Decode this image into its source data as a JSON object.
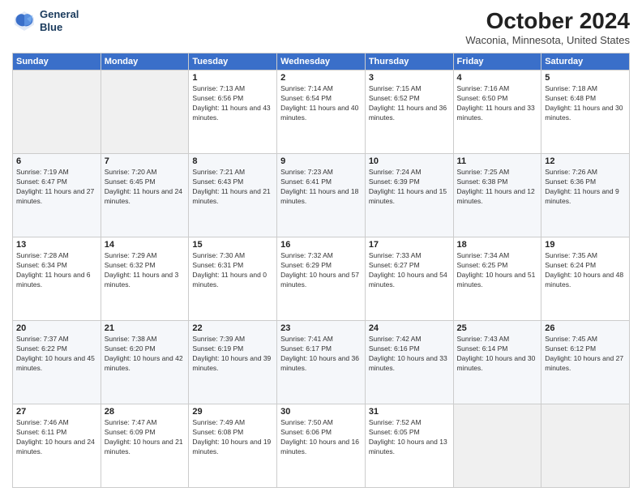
{
  "logo": {
    "line1": "General",
    "line2": "Blue"
  },
  "title": "October 2024",
  "location": "Waconia, Minnesota, United States",
  "days_of_week": [
    "Sunday",
    "Monday",
    "Tuesday",
    "Wednesday",
    "Thursday",
    "Friday",
    "Saturday"
  ],
  "weeks": [
    [
      {
        "num": "",
        "info": ""
      },
      {
        "num": "",
        "info": ""
      },
      {
        "num": "1",
        "info": "Sunrise: 7:13 AM\nSunset: 6:56 PM\nDaylight: 11 hours and 43 minutes."
      },
      {
        "num": "2",
        "info": "Sunrise: 7:14 AM\nSunset: 6:54 PM\nDaylight: 11 hours and 40 minutes."
      },
      {
        "num": "3",
        "info": "Sunrise: 7:15 AM\nSunset: 6:52 PM\nDaylight: 11 hours and 36 minutes."
      },
      {
        "num": "4",
        "info": "Sunrise: 7:16 AM\nSunset: 6:50 PM\nDaylight: 11 hours and 33 minutes."
      },
      {
        "num": "5",
        "info": "Sunrise: 7:18 AM\nSunset: 6:48 PM\nDaylight: 11 hours and 30 minutes."
      }
    ],
    [
      {
        "num": "6",
        "info": "Sunrise: 7:19 AM\nSunset: 6:47 PM\nDaylight: 11 hours and 27 minutes."
      },
      {
        "num": "7",
        "info": "Sunrise: 7:20 AM\nSunset: 6:45 PM\nDaylight: 11 hours and 24 minutes."
      },
      {
        "num": "8",
        "info": "Sunrise: 7:21 AM\nSunset: 6:43 PM\nDaylight: 11 hours and 21 minutes."
      },
      {
        "num": "9",
        "info": "Sunrise: 7:23 AM\nSunset: 6:41 PM\nDaylight: 11 hours and 18 minutes."
      },
      {
        "num": "10",
        "info": "Sunrise: 7:24 AM\nSunset: 6:39 PM\nDaylight: 11 hours and 15 minutes."
      },
      {
        "num": "11",
        "info": "Sunrise: 7:25 AM\nSunset: 6:38 PM\nDaylight: 11 hours and 12 minutes."
      },
      {
        "num": "12",
        "info": "Sunrise: 7:26 AM\nSunset: 6:36 PM\nDaylight: 11 hours and 9 minutes."
      }
    ],
    [
      {
        "num": "13",
        "info": "Sunrise: 7:28 AM\nSunset: 6:34 PM\nDaylight: 11 hours and 6 minutes."
      },
      {
        "num": "14",
        "info": "Sunrise: 7:29 AM\nSunset: 6:32 PM\nDaylight: 11 hours and 3 minutes."
      },
      {
        "num": "15",
        "info": "Sunrise: 7:30 AM\nSunset: 6:31 PM\nDaylight: 11 hours and 0 minutes."
      },
      {
        "num": "16",
        "info": "Sunrise: 7:32 AM\nSunset: 6:29 PM\nDaylight: 10 hours and 57 minutes."
      },
      {
        "num": "17",
        "info": "Sunrise: 7:33 AM\nSunset: 6:27 PM\nDaylight: 10 hours and 54 minutes."
      },
      {
        "num": "18",
        "info": "Sunrise: 7:34 AM\nSunset: 6:25 PM\nDaylight: 10 hours and 51 minutes."
      },
      {
        "num": "19",
        "info": "Sunrise: 7:35 AM\nSunset: 6:24 PM\nDaylight: 10 hours and 48 minutes."
      }
    ],
    [
      {
        "num": "20",
        "info": "Sunrise: 7:37 AM\nSunset: 6:22 PM\nDaylight: 10 hours and 45 minutes."
      },
      {
        "num": "21",
        "info": "Sunrise: 7:38 AM\nSunset: 6:20 PM\nDaylight: 10 hours and 42 minutes."
      },
      {
        "num": "22",
        "info": "Sunrise: 7:39 AM\nSunset: 6:19 PM\nDaylight: 10 hours and 39 minutes."
      },
      {
        "num": "23",
        "info": "Sunrise: 7:41 AM\nSunset: 6:17 PM\nDaylight: 10 hours and 36 minutes."
      },
      {
        "num": "24",
        "info": "Sunrise: 7:42 AM\nSunset: 6:16 PM\nDaylight: 10 hours and 33 minutes."
      },
      {
        "num": "25",
        "info": "Sunrise: 7:43 AM\nSunset: 6:14 PM\nDaylight: 10 hours and 30 minutes."
      },
      {
        "num": "26",
        "info": "Sunrise: 7:45 AM\nSunset: 6:12 PM\nDaylight: 10 hours and 27 minutes."
      }
    ],
    [
      {
        "num": "27",
        "info": "Sunrise: 7:46 AM\nSunset: 6:11 PM\nDaylight: 10 hours and 24 minutes."
      },
      {
        "num": "28",
        "info": "Sunrise: 7:47 AM\nSunset: 6:09 PM\nDaylight: 10 hours and 21 minutes."
      },
      {
        "num": "29",
        "info": "Sunrise: 7:49 AM\nSunset: 6:08 PM\nDaylight: 10 hours and 19 minutes."
      },
      {
        "num": "30",
        "info": "Sunrise: 7:50 AM\nSunset: 6:06 PM\nDaylight: 10 hours and 16 minutes."
      },
      {
        "num": "31",
        "info": "Sunrise: 7:52 AM\nSunset: 6:05 PM\nDaylight: 10 hours and 13 minutes."
      },
      {
        "num": "",
        "info": ""
      },
      {
        "num": "",
        "info": ""
      }
    ]
  ]
}
